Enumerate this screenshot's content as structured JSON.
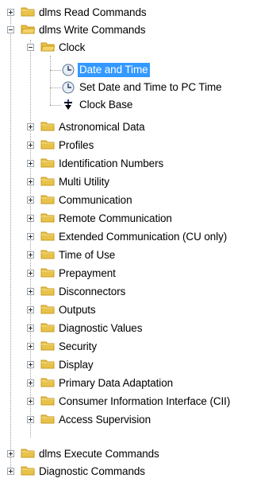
{
  "tree": {
    "nodes": [
      {
        "label": "dlms Read Commands"
      },
      {
        "label": "dlms Write Commands"
      },
      {
        "label": "Clock"
      },
      {
        "label": "Date and Time"
      },
      {
        "label": "Set Date and Time to PC Time"
      },
      {
        "label": "Clock Base"
      },
      {
        "label": "Astronomical Data"
      },
      {
        "label": "Profiles"
      },
      {
        "label": "Identification Numbers"
      },
      {
        "label": "Multi Utility"
      },
      {
        "label": "Communication"
      },
      {
        "label": "Remote Communication"
      },
      {
        "label": "Extended Communication (CU only)"
      },
      {
        "label": "Time of Use"
      },
      {
        "label": "Prepayment"
      },
      {
        "label": "Disconnectors"
      },
      {
        "label": "Outputs"
      },
      {
        "label": "Diagnostic Values"
      },
      {
        "label": "Security"
      },
      {
        "label": "Display"
      },
      {
        "label": "Primary Data Adaptation"
      },
      {
        "label": "Consumer Information Interface (CII)"
      },
      {
        "label": "Access Supervision"
      },
      {
        "label": "dlms Execute Commands"
      },
      {
        "label": "Diagnostic Commands"
      }
    ],
    "selected_label": "Date and Time",
    "colors": {
      "selection": "#3399ff",
      "folder": "#e8c34a",
      "folder_dark": "#c99a1e"
    }
  }
}
